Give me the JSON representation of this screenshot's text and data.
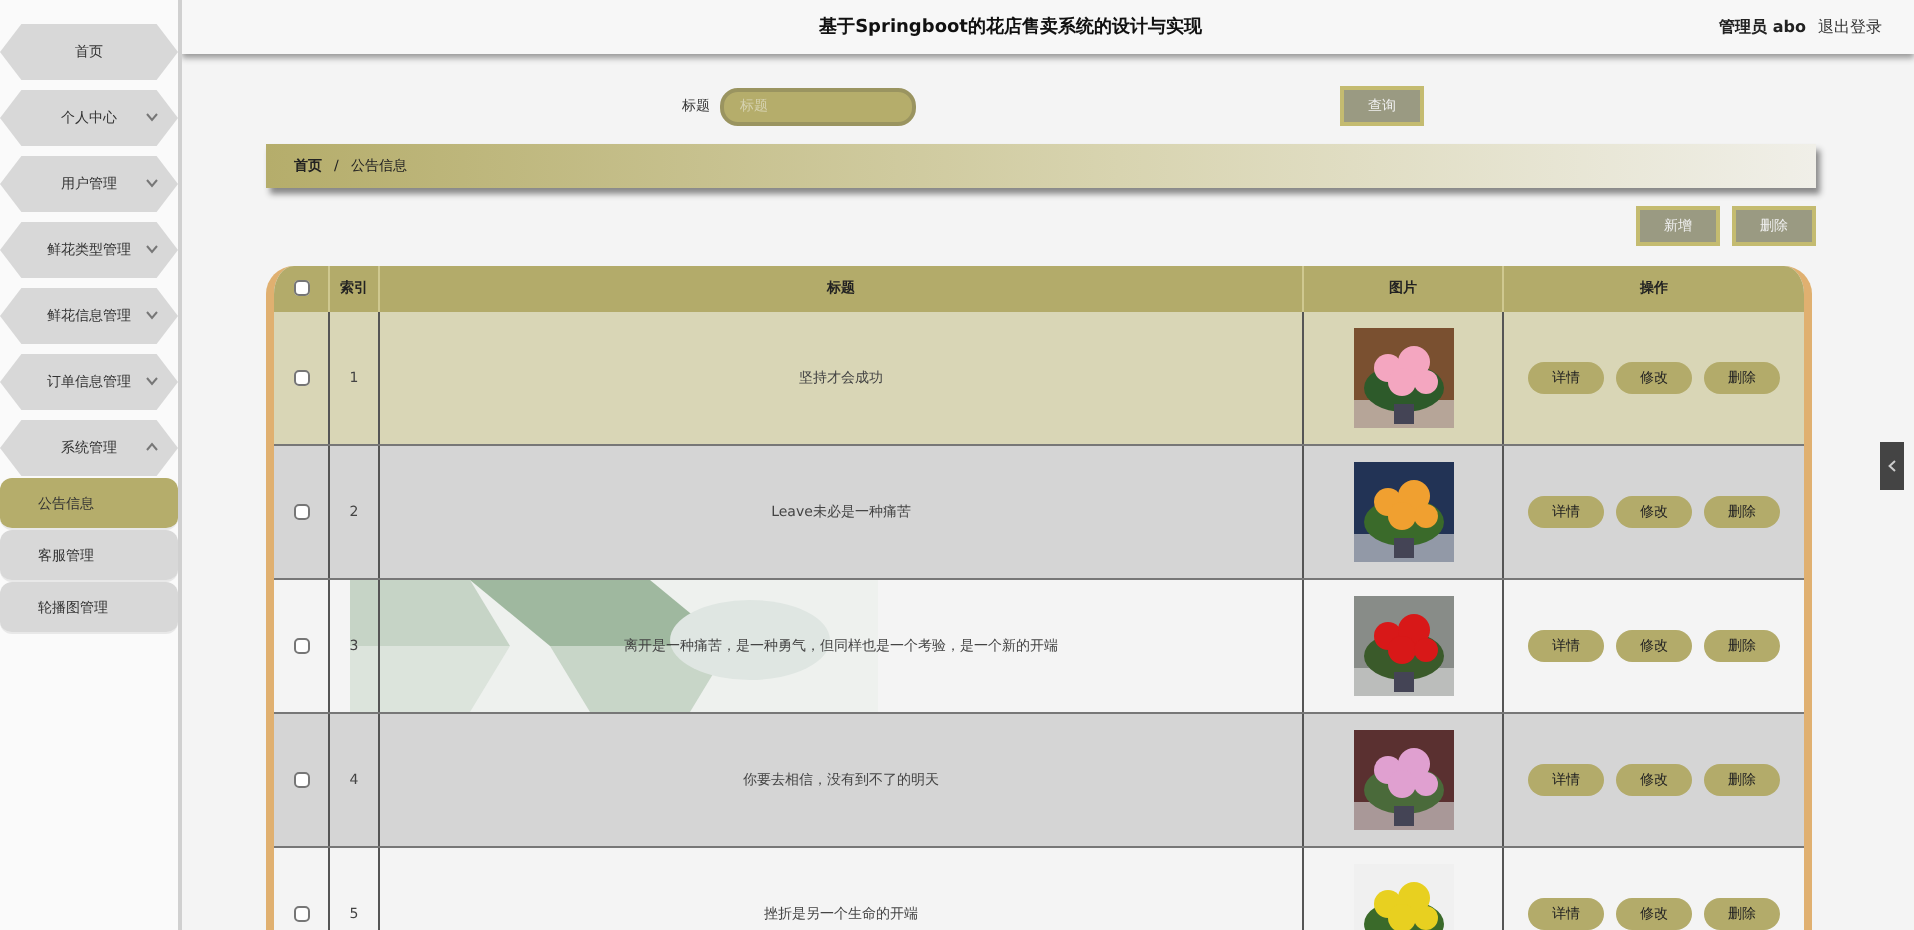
{
  "header": {
    "title": "基于Springboot的花店售卖系统的设计与实现",
    "user": "管理员 abo",
    "logout": "退出登录"
  },
  "sidebar": {
    "items": [
      {
        "label": "首页",
        "expandable": false
      },
      {
        "label": "个人中心",
        "expandable": true,
        "expanded": false
      },
      {
        "label": "用户管理",
        "expandable": true,
        "expanded": false
      },
      {
        "label": "鲜花类型管理",
        "expandable": true,
        "expanded": false
      },
      {
        "label": "鲜花信息管理",
        "expandable": true,
        "expanded": false
      },
      {
        "label": "订单信息管理",
        "expandable": true,
        "expanded": false
      },
      {
        "label": "系统管理",
        "expandable": true,
        "expanded": true,
        "children": [
          {
            "label": "公告信息",
            "selected": true
          },
          {
            "label": "客服管理",
            "selected": false
          },
          {
            "label": "轮播图管理",
            "selected": false
          }
        ]
      }
    ]
  },
  "search": {
    "label": "标题",
    "placeholder": "标题",
    "button": "查询"
  },
  "breadcrumb": {
    "items": [
      "首页",
      "公告信息"
    ],
    "separator": "/"
  },
  "toolbar": {
    "buttons": [
      "新增",
      "删除"
    ]
  },
  "table": {
    "all_checked": false,
    "columns": [
      "索引",
      "标题",
      "图片",
      "操作"
    ],
    "rows": [
      {
        "checked": false,
        "highlighted": true,
        "index": "1",
        "title": "坚持才会成功",
        "image": {
          "kind": "picture"
        },
        "actions": [
          "详情",
          "修改",
          "删除"
        ]
      },
      {
        "checked": false,
        "highlighted": false,
        "index": "2",
        "title": "Leave未必是一种痛苦",
        "image": {
          "kind": "picture"
        },
        "actions": [
          "详情",
          "修改",
          "删除"
        ]
      },
      {
        "checked": false,
        "highlighted": false,
        "index": "3",
        "title": "离开是一种痛苦，是一种勇气，但同样也是一个考验，是一个新的开端",
        "image": {
          "kind": "picture"
        },
        "backdrop": {
          "kind": "picture"
        },
        "actions": [
          "详情",
          "修改",
          "删除"
        ]
      },
      {
        "checked": false,
        "highlighted": false,
        "index": "4",
        "title": "你要去相信，没有到不了的明天",
        "image": {
          "kind": "picture"
        },
        "actions": [
          "详情",
          "修改",
          "删除"
        ]
      },
      {
        "checked": false,
        "highlighted": false,
        "index": "5",
        "title": "挫折是另一个生命的开端",
        "image": {
          "kind": "picture"
        },
        "actions": [
          "详情",
          "修改",
          "删除"
        ]
      }
    ]
  }
}
